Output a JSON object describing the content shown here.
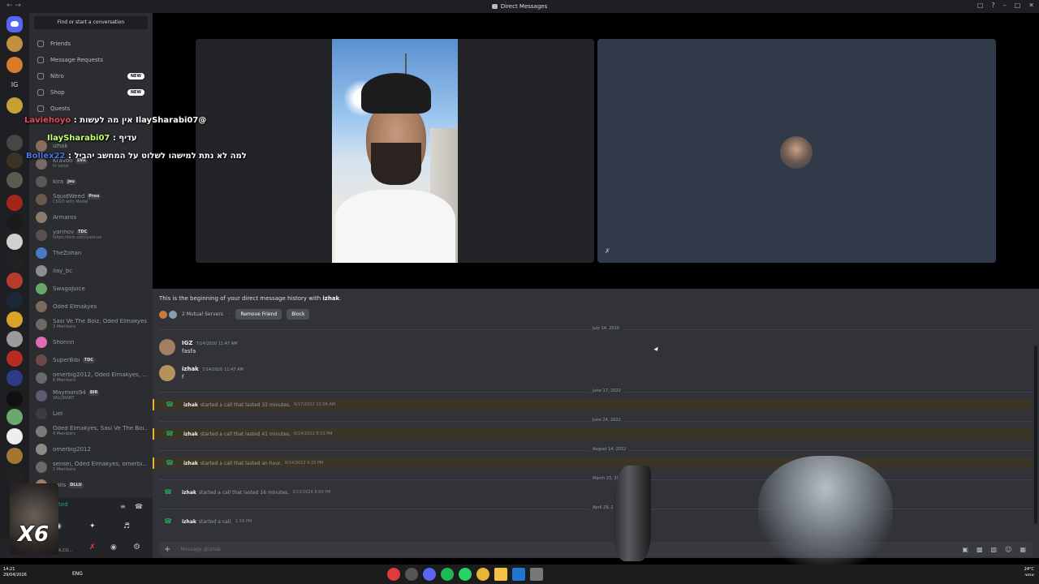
{
  "window": {
    "title": "Direct Messages",
    "nav_icon": "back-forward-arrows"
  },
  "rail": {
    "home_icon": "discord-logo",
    "label_ig": "IG"
  },
  "sidebar": {
    "search_placeholder": "Find or start a conversation",
    "nav": [
      {
        "label": "Friends",
        "icon": "friends-icon"
      },
      {
        "label": "Message Requests",
        "icon": "mail-icon"
      },
      {
        "label": "Nitro",
        "icon": "nitro-icon",
        "badge": "NEW"
      },
      {
        "label": "Shop",
        "icon": "shop-icon",
        "badge": "NEW"
      },
      {
        "label": "Quests",
        "icon": "quests-icon"
      }
    ],
    "dms": [
      {
        "name": "izhak",
        "status": "",
        "color": "#8a6e5a"
      },
      {
        "name": "Kravon",
        "tag": "SVR",
        "status": "In voice",
        "color": "#7a6a66"
      },
      {
        "name": "kira",
        "tag": "jeu",
        "status": "",
        "color": "#5d5958"
      },
      {
        "name": "SquidWeed",
        "tag": "Proo",
        "status": "CSGO with Medal",
        "color": "#6b5a4c"
      },
      {
        "name": "Armaros",
        "status": "",
        "color": "#8c7b6a"
      },
      {
        "name": "yarinov",
        "tag": "TDC",
        "status": "https://kick.com/yarinov",
        "color": "#5a5050"
      },
      {
        "name": "TheZohan",
        "status": "",
        "color": "#4a79c2"
      },
      {
        "name": "ilay_bc",
        "status": "",
        "color": "#8d8e8f"
      },
      {
        "name": "SwagaJuice",
        "status": "",
        "color": "#6aa66a"
      },
      {
        "name": "Oded Elmakyes",
        "status": "",
        "color": "#7c6a5c"
      },
      {
        "name": "Sasi Ve The Boiz, Oded Elmakyes",
        "status": "3 Members",
        "color": "#6d6a66"
      },
      {
        "name": "Shonnn",
        "status": "",
        "color": "#e06cb5"
      },
      {
        "name": "SuperBibi",
        "tag": "TDC",
        "status": "",
        "color": "#6d4a4a"
      },
      {
        "name": "omerbig2012, Oded Elmakyes, ...",
        "status": "6 Members",
        "color": "#6a6a6a"
      },
      {
        "name": "Maymoni94",
        "tag": "BIR",
        "status": "VALORANT",
        "color": "#5d5b73"
      },
      {
        "name": "Liel",
        "status": "",
        "color": "#3c3c3c"
      },
      {
        "name": "Oded Elmakyes, Sasi Ve The Boi...",
        "status": "4 Members",
        "color": "#7b7a78"
      },
      {
        "name": "omerbig2012",
        "status": "",
        "color": "#8b8a86"
      },
      {
        "name": "sensei, Oded Elmakyes, omerbi...",
        "status": "5 Members",
        "color": "#6b6865"
      },
      {
        "name": "galis",
        "tag": "DLLU",
        "status": "",
        "color": "#9c7e6b"
      }
    ],
    "voice_status": "ected",
    "user_status": "KICK.CO..."
  },
  "stream_overlay": {
    "x6": "X6",
    "messages": [
      {
        "user": "Laviehoyo",
        "text": "@IlaySharabi07 אין מה לעשות"
      },
      {
        "user": "IlaySharabi07",
        "text": "עדיף :"
      },
      {
        "user": "Bollex22",
        "text": "למה לא נתת למישהו לשלוט על המחשב יהביל :"
      }
    ]
  },
  "chat": {
    "begin_prefix": "This is the beginning of your direct message history with ",
    "begin_user": "izhak",
    "begin_suffix": ".",
    "mutual_servers": "2 Mutual Servers",
    "remove_friend": "Remove Friend",
    "block": "Block",
    "dates": [
      "July 14, 2020",
      "June 17, 2022",
      "June 24, 2022",
      "August 14, 2022",
      "March 23, 2026",
      "April 29, 2026"
    ],
    "messages": [
      {
        "author": "IGZ",
        "time": "7/14/2020 11:47 AM",
        "text": "fasfa"
      },
      {
        "author": "izhak",
        "time": "7/14/2020 11:47 AM",
        "text": "f"
      }
    ],
    "calls": [
      {
        "author": "izhak",
        "text": "started a call that lasted 33 minutes.",
        "time": "6/17/2022 12:08 AM"
      },
      {
        "author": "izhak",
        "text": "started a call that lasted 41 minutes.",
        "time": "6/24/2022 8:53 PM"
      },
      {
        "author": "izhak",
        "text": "started a call that lasted an hour.",
        "time": "8/14/2022 9:23 PM"
      },
      {
        "author": "izhak",
        "text": "started a call that lasted 16 minutes.",
        "time": "3/23/2026 8:00 PM"
      },
      {
        "author": "izhak",
        "text": "started a call.",
        "time": "1:59 PM"
      }
    ],
    "composer_placeholder": "Message @izhak"
  },
  "taskbar": {
    "time": "14:21",
    "date": "29/04/2026",
    "lang": "ENG",
    "weather": "24°C",
    "weather_desc": "שמשי"
  }
}
